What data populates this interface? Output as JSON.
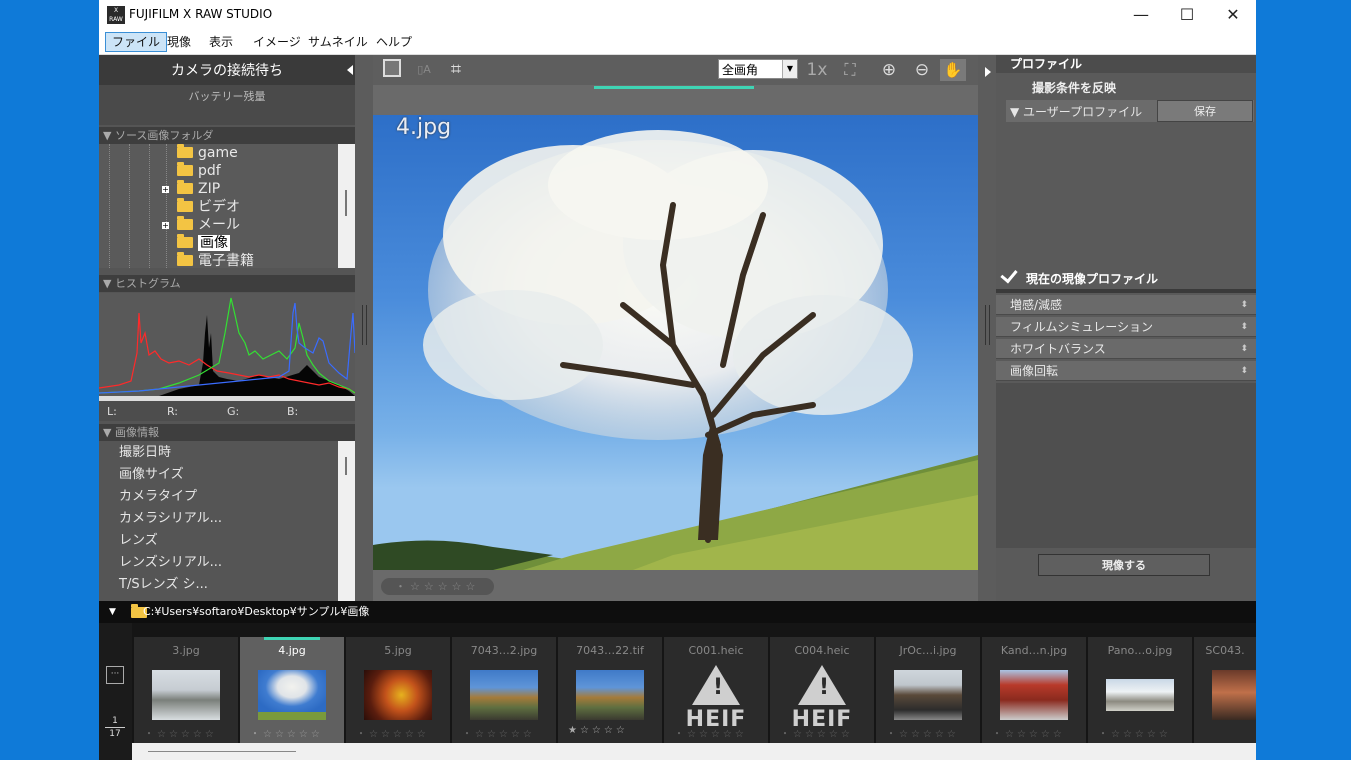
{
  "window": {
    "title": "FUJIFILM X RAW STUDIO",
    "minimize": "—",
    "maximize": "☐",
    "close": "✕",
    "logo_text": "X RAW"
  },
  "menu": [
    "ファイル",
    "現像",
    "表示",
    "イメージ",
    "サムネイル",
    "ヘルプ"
  ],
  "left_panel": {
    "camera_status": "カメラの接続待ち",
    "battery_label": "バッテリー残量",
    "source_header": "▼ ソース画像フォルダ",
    "folders": [
      "game",
      "pdf",
      "ZIP",
      "ビデオ",
      "メール",
      "画像",
      "電子書籍"
    ],
    "selected_folder": "画像",
    "histogram_header": "▼ ヒストグラム",
    "histogram_labels": {
      "l": "L:",
      "r": "R:",
      "g": "G:",
      "b": "B:"
    },
    "image_info_header": "▼ 画像情報",
    "image_info_items": [
      "撮影日時",
      "画像サイズ",
      "カメラタイプ",
      "カメラシリアル...",
      "レンズ",
      "レンズシリアル...",
      "T/Sレンズ シ..."
    ]
  },
  "center": {
    "zoom_value": "全画角",
    "zoom_1x": "1x",
    "image_name": "4.jpg",
    "rating_stars": "・☆☆☆☆☆"
  },
  "right_panel": {
    "header": "プロファイル",
    "apply_conditions": "撮影条件を反映",
    "user_profile": "▼ ユーザープロファイル",
    "save_button": "保存",
    "current_profile": "現在の現像プロファイル",
    "adjustments": [
      "増感/減感",
      "フィルムシミュレーション",
      "ホワイトバランス",
      "画像回転"
    ],
    "develop_button": "現像する"
  },
  "path": "C:¥Users¥softaro¥Desktop¥サンプル¥画像",
  "page_indicator": {
    "current": "1",
    "total": "17"
  },
  "more_button": "···",
  "thumbnails": [
    {
      "name": "3.jpg",
      "stars": "・☆☆☆☆☆"
    },
    {
      "name": "4.jpg",
      "stars": "・☆☆☆☆☆"
    },
    {
      "name": "5.jpg",
      "stars": "・☆☆☆☆☆"
    },
    {
      "name": "7043…2.jpg",
      "stars": "・☆☆☆☆☆"
    },
    {
      "name": "7043…22.tif",
      "stars": "★☆☆☆☆"
    },
    {
      "name": "C001.heic",
      "stars": "・☆☆☆☆☆",
      "heif_label": "HEIF"
    },
    {
      "name": "C004.heic",
      "stars": "・☆☆☆☆☆",
      "heif_label": "HEIF"
    },
    {
      "name": "JrOc…i.jpg",
      "stars": "・☆☆☆☆☆"
    },
    {
      "name": "Kand…n.jpg",
      "stars": "・☆☆☆☆☆"
    },
    {
      "name": "Pano…o.jpg",
      "stars": "・☆☆☆☆☆"
    },
    {
      "name": "SC043.",
      "stars": ""
    }
  ],
  "colors": {
    "accent": "#3fd4b4",
    "desktop": "#0f7ad8",
    "panel": "#5a5a5a",
    "folder": "#f3c443"
  }
}
